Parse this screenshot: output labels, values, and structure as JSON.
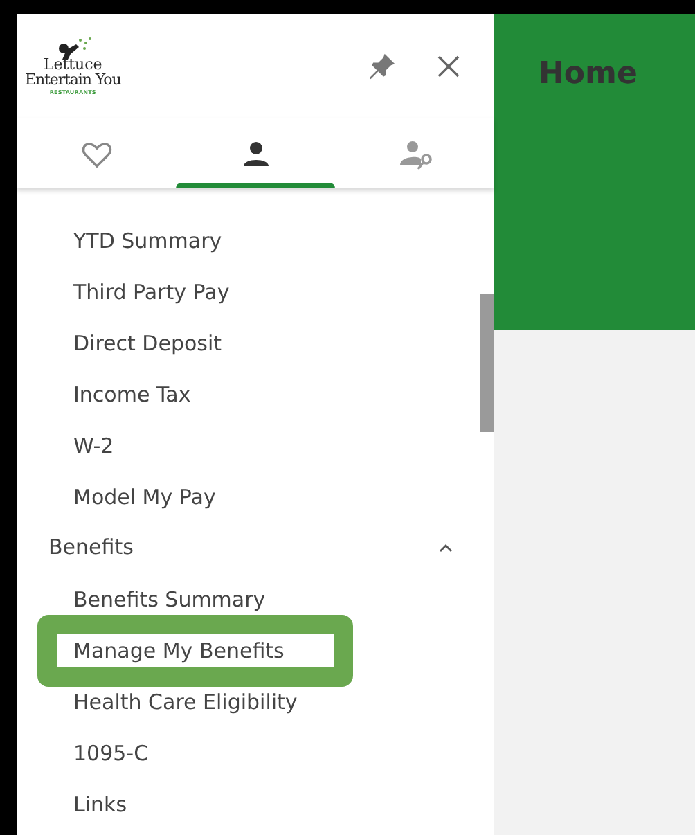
{
  "logo": {
    "line_1": "Lettuce",
    "line_2": "Entertain You",
    "line_3": "RESTAURANTS"
  },
  "tabs": [
    {
      "kind": "favorites",
      "selected": false
    },
    {
      "kind": "person",
      "selected": true
    },
    {
      "kind": "person-key",
      "selected": false
    }
  ],
  "nav_items": [
    {
      "kind": "link",
      "label": "YTD Summary",
      "highlighted": false
    },
    {
      "kind": "link",
      "label": "Third Party Pay",
      "highlighted": false
    },
    {
      "kind": "link",
      "label": "Direct Deposit",
      "highlighted": false
    },
    {
      "kind": "link",
      "label": "Income Tax",
      "highlighted": false
    },
    {
      "kind": "link",
      "label": "W-2",
      "highlighted": false
    },
    {
      "kind": "link",
      "label": "Model My Pay",
      "highlighted": false
    },
    {
      "kind": "group",
      "label": "Benefits",
      "expanded": true,
      "children": [
        {
          "label": "Benefits Summary",
          "highlighted": false
        },
        {
          "label": "Manage My Benefits",
          "highlighted": true
        },
        {
          "label": "Health Care Eligibility",
          "highlighted": false
        },
        {
          "label": "1095-C",
          "highlighted": false
        },
        {
          "label": "Links",
          "highlighted": false
        }
      ]
    }
  ],
  "page_title": "Home"
}
